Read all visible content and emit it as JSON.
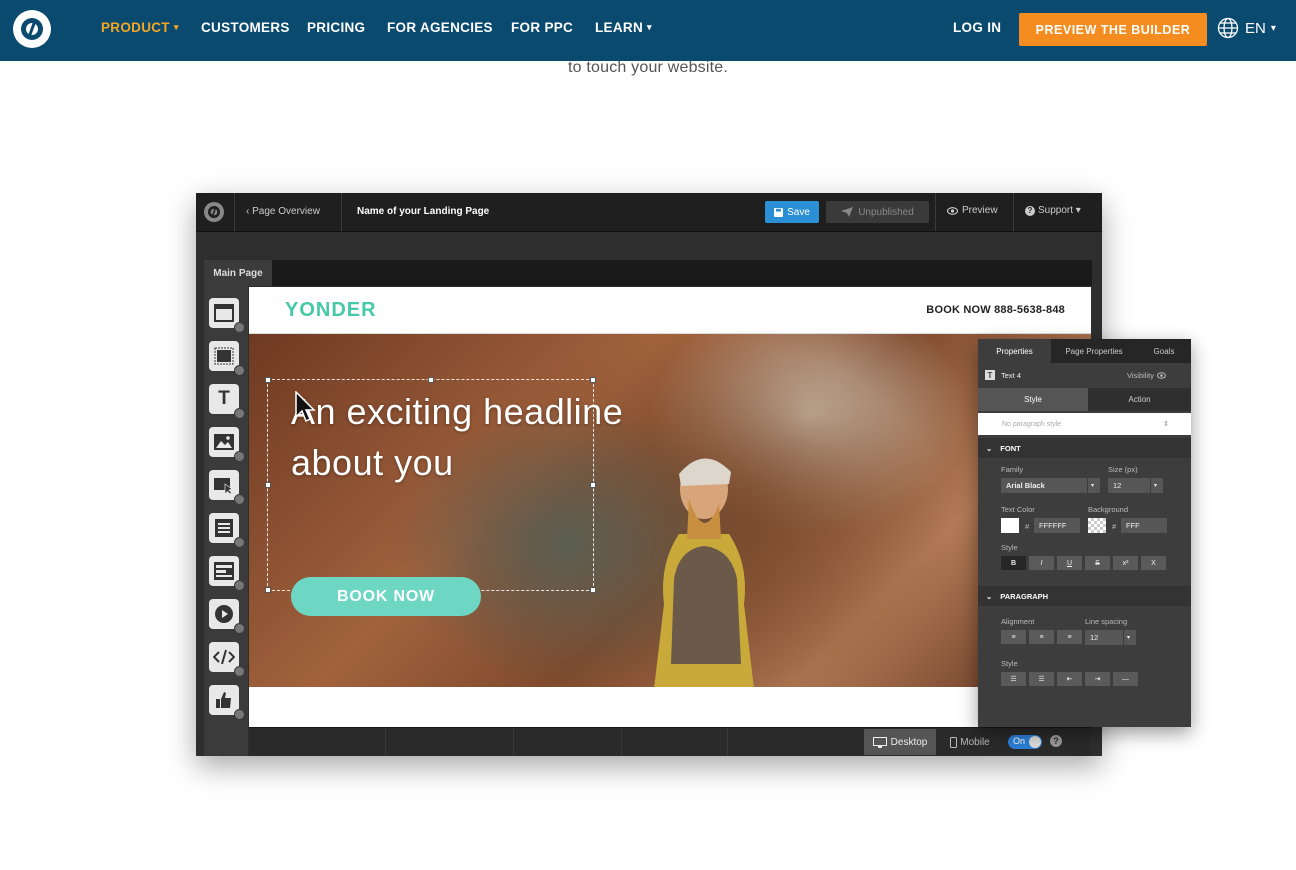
{
  "nav": {
    "items": [
      {
        "label": "PRODUCT",
        "caret": "▾",
        "active": true
      },
      {
        "label": "CUSTOMERS"
      },
      {
        "label": "PRICING"
      },
      {
        "label": "FOR AGENCIES"
      },
      {
        "label": "FOR PPC"
      },
      {
        "label": "LEARN",
        "caret": "▾"
      }
    ],
    "login": "LOG IN",
    "cta": "PREVIEW THE BUILDER",
    "lang": "EN",
    "lang_caret": "▾"
  },
  "intro_text": "to touch your website.",
  "builder": {
    "back_label": "‹ Page Overview",
    "page_name": "Name of your Landing Page",
    "save_label": "Save",
    "unpublished_label": "Unpublished",
    "preview_label": "Preview",
    "support_label": "Support ▾",
    "main_tab": "Main Page",
    "canvas": {
      "brand": "YONDER",
      "book_phone": "BOOK NOW 888-5638-848",
      "headline_line1": "An exciting headline",
      "headline_line2": "about you",
      "cta": "BOOK NOW"
    },
    "bottom": {
      "desktop": "Desktop",
      "mobile": "Mobile",
      "toggle": "On",
      "help": "?"
    }
  },
  "panel": {
    "tabs": [
      "Properties",
      "Page Properties",
      "Goals"
    ],
    "element_name": "Text 4",
    "visibility_label": "Visibility",
    "subtabs": [
      "Style",
      "Action"
    ],
    "paragraph_style": "No paragraph style",
    "font_section": "FONT",
    "family_label": "Family",
    "family_value": "Arial Black",
    "size_label": "Size (px)",
    "size_value": "12",
    "text_color_label": "Text Color",
    "text_color_value": "FFFFFF",
    "background_label": "Background",
    "background_value": "FFF",
    "style_label": "Style",
    "style_buttons": [
      "B",
      "I",
      "U",
      "S",
      "x²",
      "X"
    ],
    "paragraph_section": "PARAGRAPH",
    "alignment_label": "Alignment",
    "line_spacing_label": "Line spacing",
    "line_spacing_value": "12",
    "para_style_label": "Style"
  },
  "colors": {
    "nav_bg": "#0b4a6f",
    "nav_active": "#f5a623",
    "cta_orange": "#f58c1f",
    "brand_teal": "#46c9a8",
    "save_blue": "#2b8fd6"
  }
}
